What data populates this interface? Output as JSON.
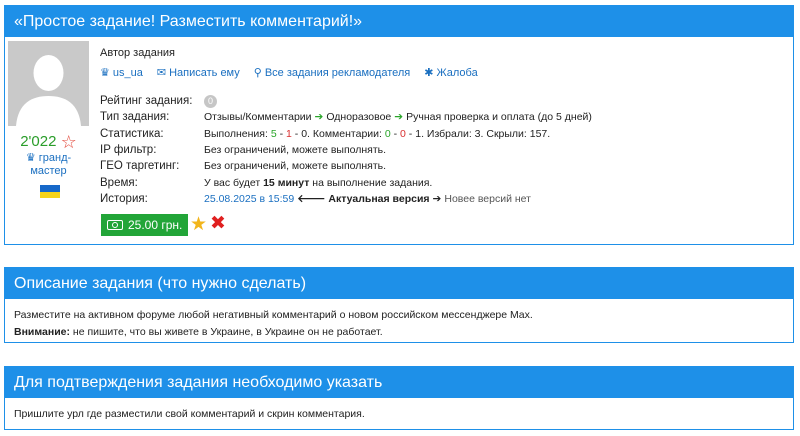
{
  "task": {
    "title": "«Простое задание! Разместить комментарий!»",
    "author_label": "Автор задания",
    "author_name": "us_ua",
    "link_write": "Написать ему",
    "link_all_tasks": "Все задания рекламодателя",
    "link_complaint": "Жалоба",
    "author_rating": "2'022",
    "rank_line1": "гранд-",
    "rank_line2": "мастер",
    "rows": {
      "rating_label": "Рейтинг задания:",
      "rating_value": "0",
      "type_label": "Тип задания:",
      "type_1": "Отзывы/Комментарии",
      "type_2": "Одноразовое",
      "type_3": "Ручная проверка и оплата (до 5 дней)",
      "stats_label": "Статистика:",
      "stats_prefix": "Выполнения:",
      "stats_exec_ok": "5",
      "stats_exec_bad": "1",
      "stats_exec_wait": "0",
      "stats_comments": "Комментарии:",
      "stats_com_ok": "0",
      "stats_com_bad": "0",
      "stats_com_wait": "1",
      "stats_tail": "Избрали: 3. Скрыли: 157.",
      "ip_label": "IP фильтр:",
      "ip_value": "Без ограничений, можете выполнять.",
      "geo_label": "ГЕО таргетинг:",
      "geo_value": "Без ограничений, можете выполнять.",
      "time_label": "Время:",
      "time_pre": "У вас будет",
      "time_bold": "15 минут",
      "time_post": "на выполнение задания.",
      "history_label": "История:",
      "history_date": "25.08.2025 в 15:59",
      "history_current": "Актуальная версия",
      "history_newer": "Новее версий нет"
    },
    "price": "25.00 грн."
  },
  "description": {
    "title": "Описание задания (что нужно сделать)",
    "line1": "Разместите на активном форуме любой негативный комментарий о новом российском мессенджере Max.",
    "warning_label": "Внимание:",
    "warning_text": "не пишите, что вы живете в Украине, в Украине он не работает."
  },
  "confirmation": {
    "title": "Для подтверждения задания необходимо указать",
    "text": "Пришлите урл где разместили свой комментарий и скрин комментария."
  },
  "colors": {
    "header_blue": "#1e90e8",
    "price_green": "#22a538",
    "link_blue": "#1a6fc0"
  }
}
